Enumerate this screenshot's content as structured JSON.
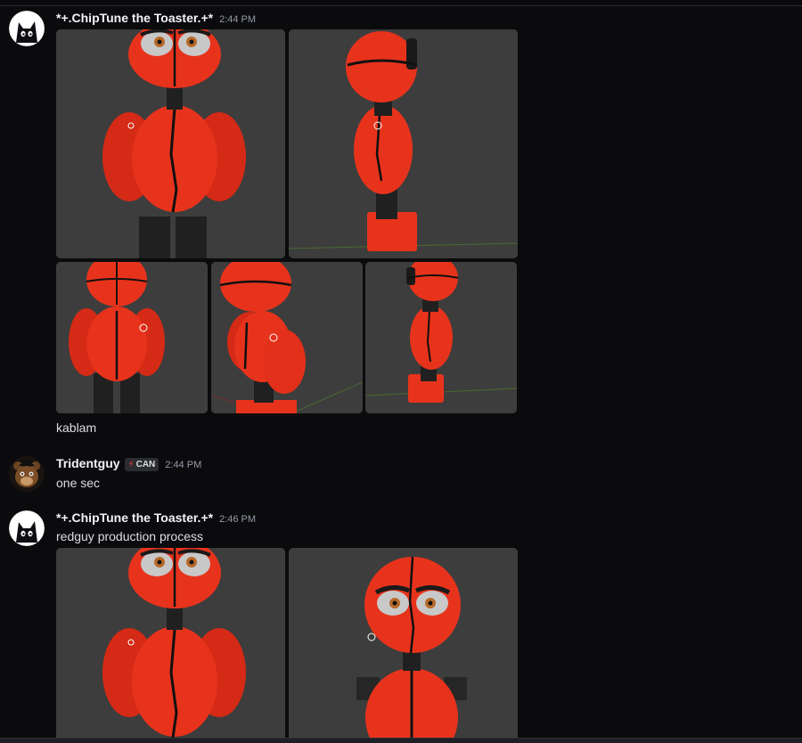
{
  "messages": [
    {
      "author": "*+.ChipTune the Toaster.+*",
      "time": "2:44 PM",
      "avatar_icon": "black-cat-avatar-icon",
      "caption": "kablam"
    },
    {
      "author": "Tridentguy",
      "time": "2:44 PM",
      "avatar_icon": "bear-animatronic-avatar-icon",
      "badge": {
        "icon": "lightning-icon",
        "label": "CAN"
      },
      "text": "one sec"
    },
    {
      "author": "*+.ChipTune the Toaster.+*",
      "time": "2:46 PM",
      "avatar_icon": "black-cat-avatar-icon",
      "text": "redguy production process"
    }
  ],
  "colors": {
    "background": "#0b0b0e",
    "username": "#f2f3f5",
    "timestamp": "#949ba4",
    "text": "#dbdee1",
    "model_red": "#e8331c",
    "viewport_grey": "#3d3d3d"
  }
}
